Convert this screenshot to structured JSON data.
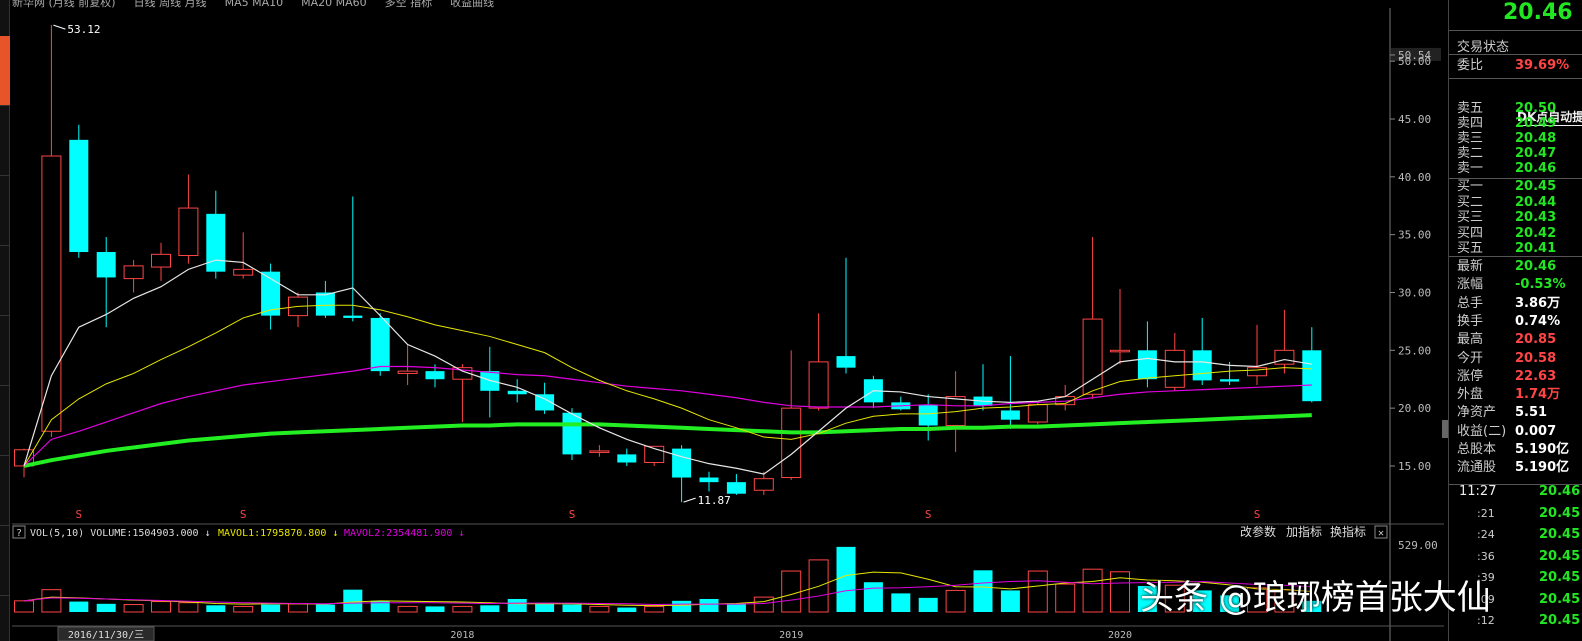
{
  "topbar": {
    "items": [
      "新华网 (月线 前复权)",
      "日线 周线 月线",
      "MA5 MA10",
      "MA20 MA60",
      "多空 指标",
      "收益曲线"
    ]
  },
  "main_chart": {
    "price_axis": [
      "50.54",
      "50.00",
      "45.00",
      "40.00",
      "35.00",
      "30.00",
      "25.00",
      "20.00",
      "15.00"
    ],
    "axis_range": [
      10.5,
      54.6
    ],
    "high_label": "53.12",
    "low_label": "11.87",
    "s_marker": "S",
    "s_markers": [
      2,
      8,
      20,
      33,
      45
    ],
    "colors": {
      "up": "#ff4545",
      "down": "#00ffff",
      "ma5": "#e6e6e6",
      "ma10": "#e6e600",
      "ma20": "#e000e0",
      "ma60": "#22ee22"
    }
  },
  "chart_data": {
    "type": "candlestick",
    "candles": [
      {
        "o": 15.0,
        "h": 16.5,
        "l": 14.0,
        "c": 16.4
      },
      {
        "o": 18.0,
        "h": 53.12,
        "l": 17.5,
        "c": 41.8
      },
      {
        "o": 43.2,
        "h": 44.5,
        "l": 33.0,
        "c": 33.5
      },
      {
        "o": 33.5,
        "h": 34.8,
        "l": 27.0,
        "c": 31.3
      },
      {
        "o": 31.2,
        "h": 32.8,
        "l": 30.0,
        "c": 32.3
      },
      {
        "o": 32.2,
        "h": 34.3,
        "l": 31.0,
        "c": 33.3
      },
      {
        "o": 33.2,
        "h": 40.2,
        "l": 32.5,
        "c": 37.3
      },
      {
        "o": 36.8,
        "h": 38.8,
        "l": 31.2,
        "c": 31.8
      },
      {
        "o": 31.5,
        "h": 35.2,
        "l": 31.2,
        "c": 32.0
      },
      {
        "o": 31.8,
        "h": 32.5,
        "l": 26.8,
        "c": 28.0
      },
      {
        "o": 28.0,
        "h": 30.0,
        "l": 27.0,
        "c": 29.6
      },
      {
        "o": 30.0,
        "h": 31.0,
        "l": 27.8,
        "c": 28.0
      },
      {
        "o": 28.0,
        "h": 38.3,
        "l": 27.5,
        "c": 27.8
      },
      {
        "o": 27.8,
        "h": 28.2,
        "l": 22.8,
        "c": 23.2
      },
      {
        "o": 23.0,
        "h": 25.5,
        "l": 22.0,
        "c": 23.2
      },
      {
        "o": 23.2,
        "h": 23.8,
        "l": 21.8,
        "c": 22.5
      },
      {
        "o": 22.5,
        "h": 23.8,
        "l": 18.8,
        "c": 23.5
      },
      {
        "o": 23.2,
        "h": 25.3,
        "l": 19.2,
        "c": 21.5
      },
      {
        "o": 21.5,
        "h": 22.5,
        "l": 20.5,
        "c": 21.2
      },
      {
        "o": 21.2,
        "h": 22.2,
        "l": 19.5,
        "c": 19.8
      },
      {
        "o": 19.6,
        "h": 20.0,
        "l": 15.5,
        "c": 16.0
      },
      {
        "o": 16.3,
        "h": 16.8,
        "l": 15.8,
        "c": 16.3
      },
      {
        "o": 16.0,
        "h": 16.5,
        "l": 15.0,
        "c": 15.3
      },
      {
        "o": 15.3,
        "h": 16.5,
        "l": 15.0,
        "c": 16.7
      },
      {
        "o": 16.5,
        "h": 16.8,
        "l": 11.87,
        "c": 14.0
      },
      {
        "o": 14.0,
        "h": 14.5,
        "l": 12.8,
        "c": 13.6
      },
      {
        "o": 13.6,
        "h": 14.3,
        "l": 12.5,
        "c": 12.6
      },
      {
        "o": 12.9,
        "h": 14.5,
        "l": 12.5,
        "c": 13.9
      },
      {
        "o": 14.0,
        "h": 25.0,
        "l": 13.8,
        "c": 20.0
      },
      {
        "o": 20.0,
        "h": 28.2,
        "l": 19.8,
        "c": 24.0
      },
      {
        "o": 24.5,
        "h": 33.0,
        "l": 23.0,
        "c": 23.5
      },
      {
        "o": 22.5,
        "h": 22.8,
        "l": 20.0,
        "c": 20.5
      },
      {
        "o": 20.5,
        "h": 21.0,
        "l": 19.8,
        "c": 19.9
      },
      {
        "o": 20.3,
        "h": 21.2,
        "l": 17.2,
        "c": 18.5
      },
      {
        "o": 18.5,
        "h": 23.2,
        "l": 16.2,
        "c": 21.0
      },
      {
        "o": 21.0,
        "h": 23.8,
        "l": 19.8,
        "c": 20.2
      },
      {
        "o": 19.8,
        "h": 24.5,
        "l": 18.2,
        "c": 19.0
      },
      {
        "o": 18.8,
        "h": 20.5,
        "l": 18.6,
        "c": 20.3
      },
      {
        "o": 20.3,
        "h": 22.0,
        "l": 19.8,
        "c": 21.0
      },
      {
        "o": 21.2,
        "h": 34.8,
        "l": 20.8,
        "c": 27.7
      },
      {
        "o": 25.0,
        "h": 30.3,
        "l": 23.8,
        "c": 25.0
      },
      {
        "o": 25.0,
        "h": 27.5,
        "l": 21.8,
        "c": 22.5
      },
      {
        "o": 21.8,
        "h": 26.5,
        "l": 21.5,
        "c": 25.0
      },
      {
        "o": 25.0,
        "h": 27.8,
        "l": 22.0,
        "c": 22.4
      },
      {
        "o": 22.5,
        "h": 24.0,
        "l": 22.0,
        "c": 22.3
      },
      {
        "o": 22.8,
        "h": 27.2,
        "l": 22.0,
        "c": 23.5
      },
      {
        "o": 23.8,
        "h": 28.5,
        "l": 23.0,
        "c": 25.0
      },
      {
        "o": 25.0,
        "h": 27.0,
        "l": 20.5,
        "c": 20.6
      }
    ],
    "ma5": [
      15.0,
      22.8,
      27.0,
      28.1,
      29.5,
      30.5,
      32.0,
      32.8,
      32.6,
      31.2,
      29.8,
      29.8,
      30.4,
      28.0,
      25.5,
      24.5,
      23.2,
      22.4,
      21.8,
      20.8,
      19.5,
      18.3,
      17.3,
      16.5,
      15.8,
      15.2,
      14.8,
      14.3,
      16.0,
      18.0,
      20.0,
      21.5,
      21.4,
      21.0,
      20.8,
      20.6,
      20.5,
      20.6,
      21.0,
      22.5,
      24.0,
      24.3,
      24.0,
      24.0,
      23.7,
      23.6,
      24.2,
      23.8
    ],
    "ma10": [
      15.0,
      19.0,
      20.8,
      22.1,
      23.0,
      24.2,
      25.3,
      26.5,
      27.8,
      28.5,
      28.8,
      28.9,
      28.9,
      28.5,
      27.9,
      27.2,
      26.7,
      26.2,
      25.5,
      24.8,
      23.5,
      22.4,
      21.5,
      20.8,
      20.0,
      19.0,
      18.3,
      17.5,
      17.3,
      17.8,
      18.7,
      19.3,
      19.5,
      19.5,
      19.7,
      20.0,
      20.1,
      20.3,
      20.4,
      21.5,
      22.3,
      22.6,
      22.8,
      23.0,
      23.2,
      23.3,
      23.5,
      23.4
    ],
    "ma20": [
      15.0,
      17.3,
      18.0,
      18.8,
      19.6,
      20.4,
      21.0,
      21.5,
      22.0,
      22.3,
      22.6,
      22.9,
      23.2,
      23.6,
      23.6,
      23.5,
      23.3,
      23.1,
      22.9,
      22.8,
      22.5,
      22.2,
      21.9,
      21.7,
      21.5,
      21.2,
      20.9,
      20.5,
      20.2,
      20.1,
      20.1,
      20.1,
      20.2,
      20.3,
      20.2,
      20.2,
      20.4,
      20.5,
      20.6,
      20.9,
      21.2,
      21.4,
      21.5,
      21.6,
      21.7,
      21.8,
      21.9,
      22.0
    ],
    "ma60": [
      15.0,
      15.5,
      15.9,
      16.3,
      16.6,
      16.9,
      17.2,
      17.4,
      17.6,
      17.8,
      17.9,
      18.0,
      18.1,
      18.2,
      18.3,
      18.4,
      18.5,
      18.5,
      18.6,
      18.6,
      18.6,
      18.6,
      18.5,
      18.4,
      18.3,
      18.2,
      18.1,
      18.0,
      17.9,
      17.9,
      18.0,
      18.1,
      18.2,
      18.2,
      18.3,
      18.3,
      18.4,
      18.4,
      18.5,
      18.6,
      18.7,
      18.8,
      18.9,
      19.0,
      19.1,
      19.2,
      19.3,
      19.4
    ],
    "volume": {
      "values": [
        30,
        60,
        28,
        22,
        20,
        28,
        25,
        18,
        15,
        20,
        22,
        20,
        60,
        30,
        15,
        15,
        15,
        18,
        35,
        25,
        20,
        15,
        12,
        15,
        30,
        35,
        22,
        40,
        110,
        140,
        175,
        80,
        50,
        38,
        58,
        112,
        58,
        110,
        75,
        115,
        108,
        70,
        72,
        58,
        45,
        65,
        60,
        30
      ],
      "ma5": [
        30,
        40,
        38,
        35,
        32,
        30,
        27,
        23,
        21,
        22,
        22,
        21,
        27,
        30,
        29,
        28,
        27,
        25,
        22,
        22,
        22,
        20,
        18,
        17,
        18,
        21,
        23,
        28,
        47,
        69,
        98,
        107,
        105,
        88,
        68,
        67,
        62,
        70,
        78,
        82,
        92,
        86,
        84,
        80,
        73,
        62,
        60,
        55
      ],
      "ma10": [
        30,
        38,
        37,
        35,
        33,
        31,
        29,
        27,
        25,
        24,
        23,
        22,
        24,
        25,
        25,
        25,
        24,
        23,
        24,
        24,
        24,
        23,
        22,
        20,
        21,
        21,
        21,
        23,
        32,
        43,
        57,
        64,
        65,
        68,
        72,
        78,
        82,
        84,
        80,
        76,
        78,
        79,
        80,
        82,
        78,
        74,
        72,
        68
      ],
      "max_label": "529.00",
      "colors": {
        "ma1": "#e6e600",
        "ma2": "#e000e0"
      }
    }
  },
  "indicator_bar": {
    "question": "?",
    "text": "VOL(5,10)  VOLUME:1504903.000 ↓ ",
    "mavol1": "MAVOL1:1795870.800 ↓",
    "mavol2": "MAVOL2:2354481.900 ↓",
    "btn_params": "改参数",
    "btn_add": "加指标",
    "btn_switch": "换指标",
    "btn_close": "✕"
  },
  "date_axis": {
    "cursor_date": "2016/11/30/三",
    "labels": [
      {
        "text": "2018",
        "index": 16
      },
      {
        "text": "2019",
        "index": 28
      },
      {
        "text": "2020",
        "index": 40
      }
    ]
  },
  "right_panel": {
    "price": "20.46",
    "status": "交易状态",
    "weibi_label": "委比",
    "weibi_val": "39.69%",
    "dk_hint": "DK点自动提示",
    "asks": [
      {
        "label": "卖五",
        "price": "20.50"
      },
      {
        "label": "卖四",
        "price": "20.49"
      },
      {
        "label": "卖三",
        "price": "20.48"
      },
      {
        "label": "卖二",
        "price": "20.47"
      },
      {
        "label": "卖一",
        "price": "20.46"
      }
    ],
    "bids": [
      {
        "label": "买一",
        "price": "20.45"
      },
      {
        "label": "买二",
        "price": "20.44"
      },
      {
        "label": "买三",
        "price": "20.43"
      },
      {
        "label": "买四",
        "price": "20.42"
      },
      {
        "label": "买五",
        "price": "20.41"
      }
    ],
    "stats": [
      {
        "label": "最新",
        "val": "20.46",
        "cls": "green"
      },
      {
        "label": "涨幅",
        "val": "-0.53%",
        "cls": "green"
      },
      {
        "label": "总手",
        "val": "3.86万",
        "cls": "white"
      },
      {
        "label": "换手",
        "val": "0.74%",
        "cls": "white"
      },
      {
        "label": "最高",
        "val": "20.85",
        "cls": "red"
      },
      {
        "label": "今开",
        "val": "20.58",
        "cls": "red"
      },
      {
        "label": "涨停",
        "val": "22.63",
        "cls": "red"
      },
      {
        "label": "外盘",
        "val": "1.74万",
        "cls": "red"
      },
      {
        "label": "净资产",
        "val": "5.51",
        "cls": "white"
      },
      {
        "label": "收益(二)",
        "val": "0.007",
        "cls": "white"
      },
      {
        "label": "总股本",
        "val": "5.190亿",
        "cls": "white"
      },
      {
        "label": "流通股",
        "val": "5.190亿",
        "cls": "white"
      }
    ],
    "ticks": [
      {
        "time": "11:27",
        "val": "20.46"
      },
      {
        "time": ":21",
        "val": "20.45"
      },
      {
        "time": ":24",
        "val": "20.45"
      },
      {
        "time": ":36",
        "val": "20.45"
      },
      {
        "time": ":39",
        "val": "20.45"
      },
      {
        "time": ":09",
        "val": "20.45"
      },
      {
        "time": ":12",
        "val": "20.45"
      }
    ]
  },
  "watermark": "头条 @琅琊榜首张大仙"
}
